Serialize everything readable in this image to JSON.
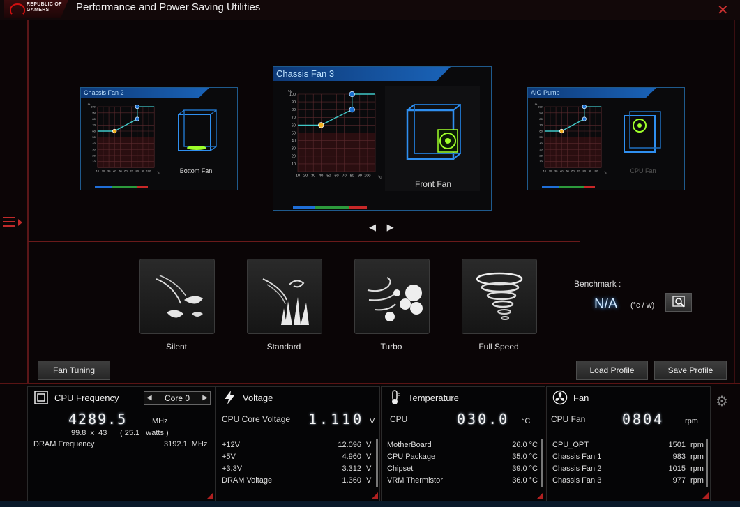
{
  "window": {
    "title": "Performance and Power Saving Utilities",
    "logo_line1": "REPUBLIC OF",
    "logo_line2": "GAMERS",
    "close_glyph": "✕"
  },
  "fan_cards": [
    {
      "title": "Chassis Fan 2",
      "label": "Bottom Fan",
      "y_ticks": [
        "100",
        "90",
        "80",
        "70",
        "60",
        "50",
        "40",
        "30",
        "20",
        "10"
      ],
      "x_ticks": [
        "10",
        "20",
        "30",
        "40",
        "50",
        "60",
        "70",
        "80",
        "90",
        "100"
      ],
      "unit_y": "%",
      "unit_x": "°c"
    },
    {
      "title": "Chassis Fan 3",
      "label": "Front Fan",
      "y_ticks": [
        "100",
        "90",
        "80",
        "70",
        "60",
        "50",
        "40",
        "30",
        "20",
        "10"
      ],
      "x_ticks": [
        "10",
        "20",
        "30",
        "40",
        "50",
        "60",
        "70",
        "80",
        "90",
        "100"
      ],
      "unit_y": "%",
      "unit_x": "°c"
    },
    {
      "title": "AIO Pump",
      "label": "CPU Fan",
      "y_ticks": [
        "100",
        "90",
        "80",
        "70",
        "60",
        "50",
        "40",
        "30",
        "20",
        "10"
      ],
      "x_ticks": [
        "10",
        "20",
        "30",
        "40",
        "50",
        "60",
        "70",
        "80",
        "90",
        "100"
      ],
      "unit_y": "%",
      "unit_x": "°c"
    }
  ],
  "nav": {
    "prev": "◀",
    "next": "▶"
  },
  "modes": [
    {
      "label": "Silent",
      "icon": "silent-leaves-icon"
    },
    {
      "label": "Standard",
      "icon": "standard-grass-icon"
    },
    {
      "label": "Turbo",
      "icon": "turbo-wind-icon"
    },
    {
      "label": "Full Speed",
      "icon": "full-speed-tornado-icon"
    }
  ],
  "benchmark": {
    "label": "Benchmark :",
    "value": "N/A",
    "unit": "(°c / w)"
  },
  "buttons": {
    "fan_tuning": "Fan Tuning",
    "load_profile": "Load Profile",
    "save_profile": "Save Profile"
  },
  "cpu": {
    "title": "CPU Frequency",
    "core": "Core 0",
    "freq": "4289.5",
    "freq_unit": "MHz",
    "ratio": "99.8  x  43",
    "watts": "( 25.1   watts )",
    "dram_label": "DRAM Frequency",
    "dram_value": "3192.1  MHz"
  },
  "voltage": {
    "title": "Voltage",
    "core_label": "CPU Core Voltage",
    "core_value": "1.110",
    "core_unit": "V",
    "rows": [
      {
        "name": "+12V",
        "value": "12.096",
        "unit": "V"
      },
      {
        "name": "+5V",
        "value": "4.960",
        "unit": "V"
      },
      {
        "name": "+3.3V",
        "value": "3.312",
        "unit": "V"
      },
      {
        "name": "DRAM Voltage",
        "value": "1.360",
        "unit": "V"
      }
    ]
  },
  "temperature": {
    "title": "Temperature",
    "cpu_label": "CPU",
    "cpu_value": "030.0",
    "cpu_unit": "°C",
    "rows": [
      {
        "name": "MotherBoard",
        "value": "26.0 °C"
      },
      {
        "name": "CPU Package",
        "value": "35.0 °C"
      },
      {
        "name": "Chipset",
        "value": "39.0 °C"
      },
      {
        "name": "VRM Thermistor",
        "value": "36.0 °C"
      }
    ]
  },
  "fan": {
    "title": "Fan",
    "cpu_label": "CPU Fan",
    "cpu_value": "0804",
    "cpu_unit": "rpm",
    "rows": [
      {
        "name": "CPU_OPT",
        "value": "1501",
        "unit": "rpm"
      },
      {
        "name": "Chassis Fan 1",
        "value": "983",
        "unit": "rpm"
      },
      {
        "name": "Chassis Fan 2",
        "value": "1015",
        "unit": "rpm"
      },
      {
        "name": "Chassis Fan 3",
        "value": "977",
        "unit": "rpm"
      }
    ]
  },
  "colors": {
    "accent_red": "#c02a2a",
    "card_blue": "#1a63b8",
    "glow_blue": "#4a9ff5"
  }
}
